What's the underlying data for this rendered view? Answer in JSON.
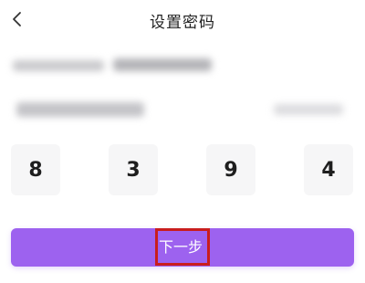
{
  "header": {
    "back_icon": "chevron-left-icon",
    "title": "设置密码"
  },
  "code": {
    "digits": [
      "8",
      "3",
      "9",
      "4"
    ]
  },
  "actions": {
    "next_label": "下一步"
  },
  "colors": {
    "accent": "#9d62ef",
    "highlight": "#c91d1d",
    "code_box_bg": "#f6f6f7"
  }
}
